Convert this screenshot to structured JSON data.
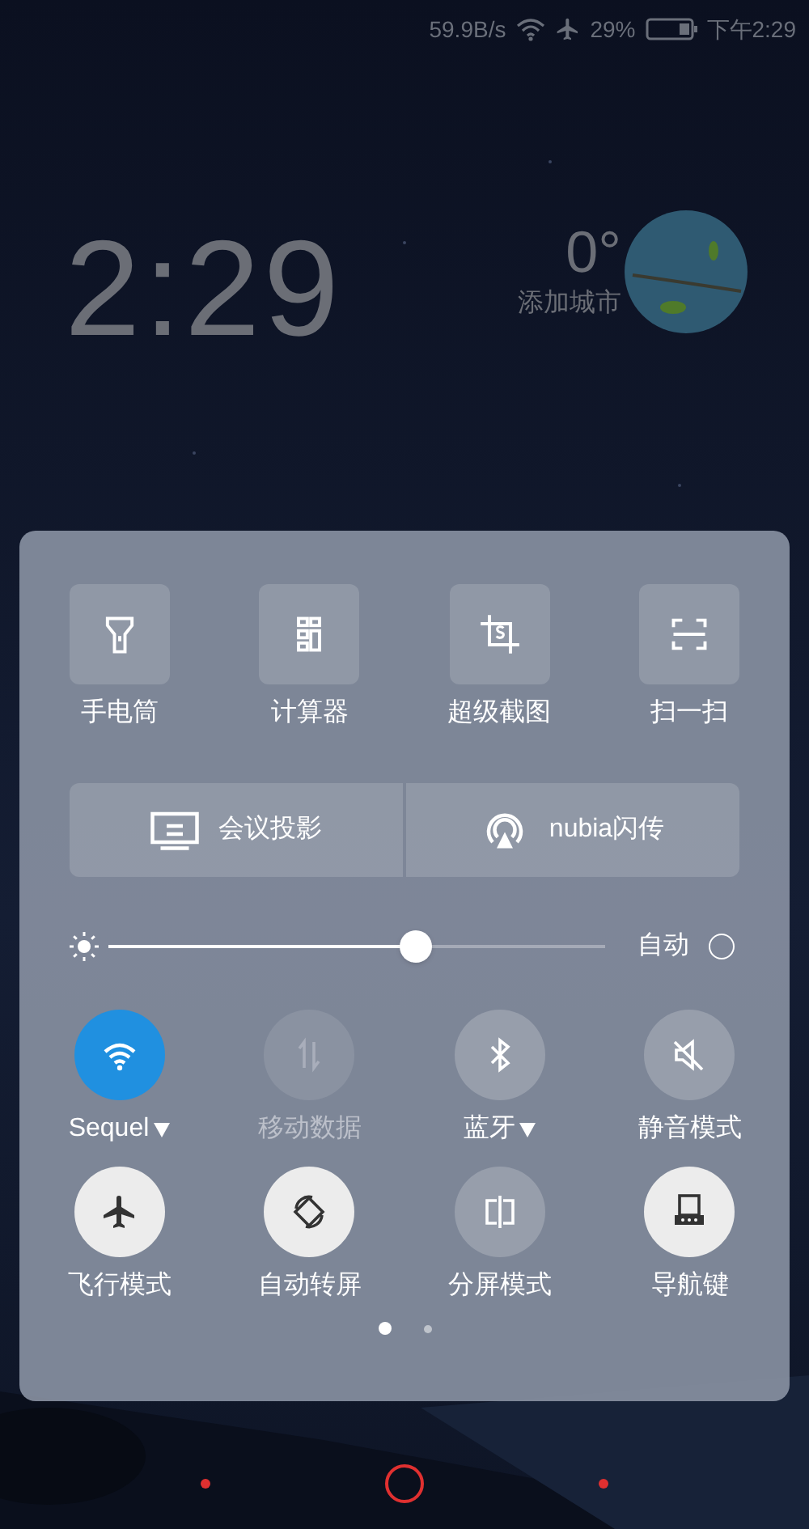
{
  "status_bar": {
    "speed": "59.9B/s",
    "battery": "29%",
    "time": "下午2:29"
  },
  "lock_clock": {
    "time": "2:29"
  },
  "weather": {
    "temperature": "0°",
    "city": "添加城市"
  },
  "shortcuts": [
    {
      "label": "手电筒"
    },
    {
      "label": "计算器"
    },
    {
      "label": "超级截图"
    },
    {
      "label": "扫一扫"
    }
  ],
  "wide_buttons": [
    {
      "label": "会议投影"
    },
    {
      "label": "nubia闪传"
    }
  ],
  "brightness": {
    "level": 0.62,
    "auto_label": "自动",
    "auto": false
  },
  "toggles": [
    {
      "label": "Sequel",
      "on": true,
      "disabled": false,
      "dropdown": true
    },
    {
      "label": "移动数据",
      "on": false,
      "disabled": true,
      "dropdown": false
    },
    {
      "label": "蓝牙",
      "on": false,
      "disabled": false,
      "dropdown": true
    },
    {
      "label": "静音模式",
      "on": false,
      "disabled": false,
      "dropdown": false
    },
    {
      "label": "飞行模式",
      "on": true,
      "disabled": false,
      "dropdown": false
    },
    {
      "label": "自动转屏",
      "on": true,
      "disabled": false,
      "dropdown": false
    },
    {
      "label": "分屏模式",
      "on": false,
      "disabled": false,
      "dropdown": false
    },
    {
      "label": "导航键",
      "on": true,
      "disabled": false,
      "dropdown": false
    }
  ],
  "pages": [
    {
      "selected": true
    },
    {
      "selected": false
    }
  ]
}
